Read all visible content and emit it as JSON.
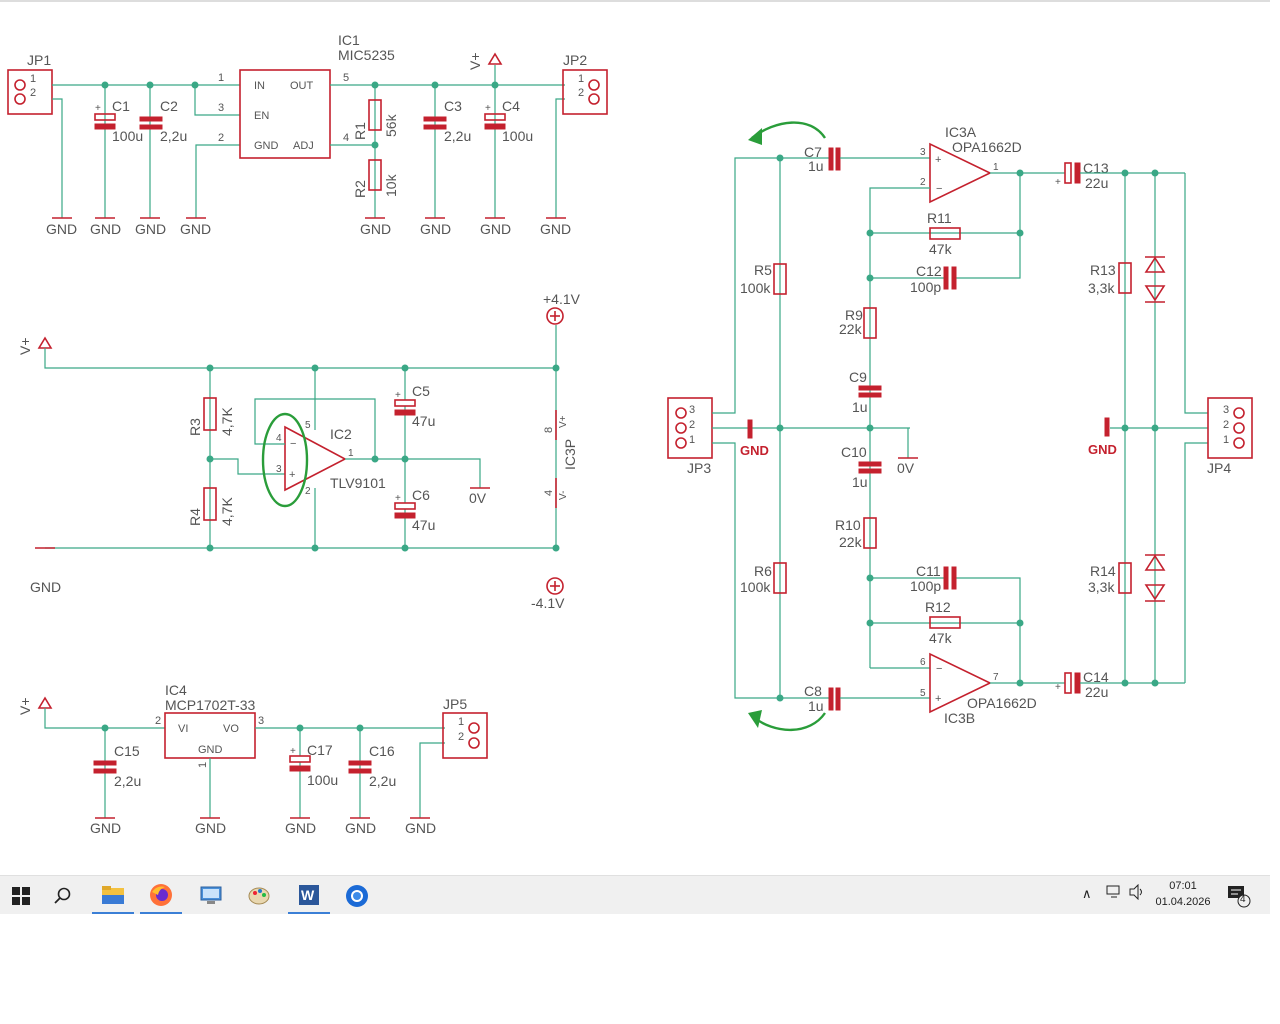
{
  "schematic": {
    "jp1": {
      "ref": "JP1",
      "pins": [
        "1",
        "2"
      ]
    },
    "jp2": {
      "ref": "JP2",
      "pins": [
        "1",
        "2"
      ]
    },
    "jp3": {
      "ref": "JP3",
      "pins": [
        "3",
        "2",
        "1"
      ]
    },
    "jp4": {
      "ref": "JP4",
      "pins": [
        "3",
        "2",
        "1"
      ]
    },
    "jp5": {
      "ref": "JP5",
      "pins": [
        "1",
        "2"
      ]
    },
    "ic1": {
      "ref": "IC1",
      "part": "MIC5235",
      "pin_in": "IN",
      "pin_out": "OUT",
      "pin_en": "EN",
      "pin_gnd": "GND",
      "pin_adj": "ADJ",
      "pin_nums": [
        "1",
        "3",
        "2",
        "5",
        "4"
      ]
    },
    "ic2": {
      "ref": "IC2",
      "part": "TLV9101",
      "pin_nums": [
        "4",
        "3",
        "5",
        "2",
        "1"
      ]
    },
    "ic3p": {
      "ref": "IC3P",
      "pin8": "8",
      "pin4": "4",
      "vplus": "V+",
      "vminus": "V-"
    },
    "ic3a": {
      "ref": "IC3A",
      "part": "OPA1662D",
      "pin_nums": [
        "3",
        "2",
        "1"
      ]
    },
    "ic3b": {
      "ref": "IC3B",
      "part": "OPA1662D",
      "pin_nums": [
        "6",
        "5",
        "7"
      ]
    },
    "ic4": {
      "ref": "IC4",
      "part": "MCP1702T-33",
      "pin_vi": "VI",
      "pin_vo": "VO",
      "pin_gnd": "GND",
      "pin_nums": [
        "2",
        "3",
        "1"
      ]
    },
    "caps": {
      "c1": {
        "ref": "C1",
        "value": "100u"
      },
      "c2": {
        "ref": "C2",
        "value": "2,2u"
      },
      "c3": {
        "ref": "C3",
        "value": "2,2u"
      },
      "c4": {
        "ref": "C4",
        "value": "100u"
      },
      "c5": {
        "ref": "C5",
        "value": "47u"
      },
      "c6": {
        "ref": "C6",
        "value": "47u"
      },
      "c7": {
        "ref": "C7",
        "value": "1u"
      },
      "c8": {
        "ref": "C8",
        "value": "1u"
      },
      "c9": {
        "ref": "C9",
        "value": "1u"
      },
      "c10": {
        "ref": "C10",
        "value": "1u"
      },
      "c11": {
        "ref": "C11",
        "value": "100p"
      },
      "c12": {
        "ref": "C12",
        "value": "100p"
      },
      "c13": {
        "ref": "C13",
        "value": "22u"
      },
      "c14": {
        "ref": "C14",
        "value": "22u"
      },
      "c15": {
        "ref": "C15",
        "value": "2,2u"
      },
      "c16": {
        "ref": "C16",
        "value": "2,2u"
      },
      "c17": {
        "ref": "C17",
        "value": "100u"
      }
    },
    "res": {
      "r1": {
        "ref": "R1",
        "value": "56k"
      },
      "r2": {
        "ref": "R2",
        "value": "10k"
      },
      "r3": {
        "ref": "R3",
        "value": "4,7K"
      },
      "r4": {
        "ref": "R4",
        "value": "4,7K"
      },
      "r5": {
        "ref": "R5",
        "value": "100k"
      },
      "r6": {
        "ref": "R6",
        "value": "100k"
      },
      "r9": {
        "ref": "R9",
        "value": "22k"
      },
      "r10": {
        "ref": "R10",
        "value": "22k"
      },
      "r11": {
        "ref": "R11",
        "value": "47k"
      },
      "r12": {
        "ref": "R12",
        "value": "47k"
      },
      "r13": {
        "ref": "R13",
        "value": "3,3k"
      },
      "r14": {
        "ref": "R14",
        "value": "3,3k"
      }
    },
    "nets": {
      "gnd": "GND",
      "vplus": "V+",
      "plus41": "+4.1V",
      "minus41": "-4.1V",
      "zero_v": "0V"
    }
  },
  "taskbar": {
    "icons": [
      "windows-start-icon",
      "search-icon",
      "file-explorer-icon",
      "firefox-icon",
      "remote-desktop-icon",
      "paint-icon",
      "word-icon",
      "thunderbird-icon"
    ],
    "clock_time": "07:01",
    "clock_date": "01.04.2026",
    "notification_count": "4"
  }
}
